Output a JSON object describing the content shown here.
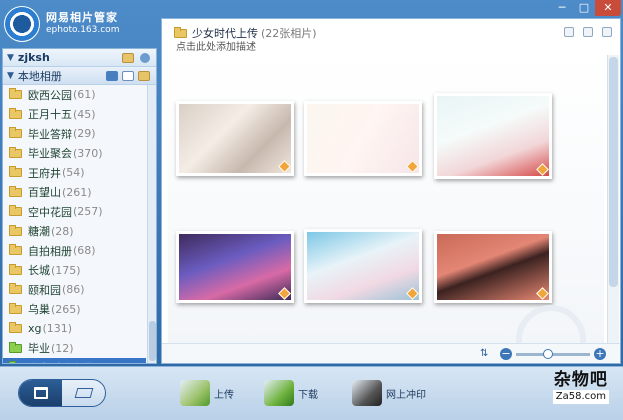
{
  "app": {
    "name": "网易相片管家",
    "site": "ephoto.163.com"
  },
  "window_controls": [
    "─",
    "□",
    "✕"
  ],
  "sidebar": {
    "user": "zjksh",
    "section_title": "本地相册",
    "albums": [
      {
        "name": "欧西公园",
        "count": "(61)",
        "color": "yellow"
      },
      {
        "name": "正月十五",
        "count": "(45)",
        "color": "yellow"
      },
      {
        "name": "毕业答辩",
        "count": "(29)",
        "color": "yellow"
      },
      {
        "name": "毕业聚会",
        "count": "(370)",
        "color": "yellow"
      },
      {
        "name": "王府井",
        "count": "(54)",
        "color": "yellow"
      },
      {
        "name": "百望山",
        "count": "(261)",
        "color": "yellow"
      },
      {
        "name": "空中花园",
        "count": "(257)",
        "color": "yellow"
      },
      {
        "name": "糖潮",
        "count": "(28)",
        "color": "yellow"
      },
      {
        "name": "自拍相册",
        "count": "(68)",
        "color": "yellow"
      },
      {
        "name": "长城",
        "count": "(175)",
        "color": "yellow"
      },
      {
        "name": "颐和园",
        "count": "(86)",
        "color": "yellow"
      },
      {
        "name": "乌巢",
        "count": "(265)",
        "color": "yellow"
      },
      {
        "name": "xg",
        "count": "(131)",
        "color": "yellow"
      },
      {
        "name": "毕业",
        "count": "(12)",
        "color": "green"
      }
    ],
    "active_album": {
      "name": "少女时代上传",
      "count": "(22)"
    }
  },
  "main": {
    "album_title": "少女时代上传",
    "album_count": "(22张相片)",
    "album_desc": "点击此处添加描述",
    "zoom_level": 0.42
  },
  "bottom": {
    "upload_label": "上传",
    "download_label": "下载",
    "print_label": "网上冲印",
    "brand_name": "杂物吧",
    "brand_site": "Za58.com"
  },
  "colors": {
    "accent": "#3875c7",
    "frame": "#2f6fae",
    "close": "#c94b3a"
  }
}
